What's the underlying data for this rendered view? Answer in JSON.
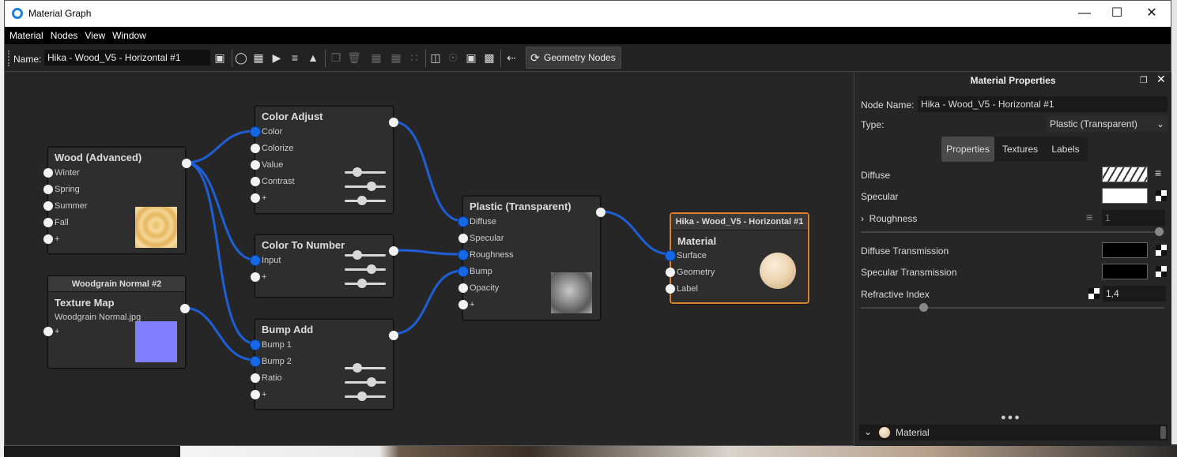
{
  "window": {
    "title": "Material Graph",
    "minimize": "—",
    "maximize": "☐",
    "close": "✕"
  },
  "menu": [
    "Material",
    "Nodes",
    "View",
    "Window"
  ],
  "toolbar": {
    "name_label": "Name:",
    "name_value": "Hika - Wood_V5 - Horizontal #1",
    "geometry_nodes_label": "Geometry Nodes"
  },
  "nodes": {
    "wood": {
      "title": "Wood (Advanced)",
      "ports": [
        "Winter",
        "Spring",
        "Summer",
        "Fall",
        "+"
      ]
    },
    "texture_map": {
      "header": "Woodgrain Normal #2",
      "title": "Texture Map",
      "filename": "Woodgrain Normal.jpg",
      "ports": [
        "+"
      ],
      "swatch_color": "#8080ff"
    },
    "color_adjust": {
      "title": "Color Adjust",
      "ports": [
        "Color",
        "Colorize",
        "Value",
        "Contrast",
        "+"
      ]
    },
    "color_to_number": {
      "title": "Color To Number",
      "ports": [
        "Input",
        "+"
      ]
    },
    "bump_add": {
      "title": "Bump Add",
      "ports": [
        "Bump 1",
        "Bump 2",
        "Ratio",
        "+"
      ]
    },
    "plastic": {
      "title": "Plastic (Transparent)",
      "ports": [
        "Diffuse",
        "Specular",
        "Roughness",
        "Bump",
        "Opacity",
        "+"
      ]
    },
    "material": {
      "header": "Hika - Wood_V5 - Horizontal #1",
      "title": "Material",
      "ports": [
        "Surface",
        "Geometry",
        "Label"
      ],
      "accent": "#d9822b"
    }
  },
  "panel": {
    "title": "Material Properties",
    "node_name_label": "Node Name:",
    "node_name_value": "Hika - Wood_V5 - Horizontal #1",
    "type_label": "Type:",
    "type_value": "Plastic (Transparent)",
    "tabs": [
      "Properties",
      "Textures",
      "Labels"
    ],
    "diffuse_label": "Diffuse",
    "specular_label": "Specular",
    "roughness_label": "Roughness",
    "roughness_value": "1",
    "diffuse_trans_label": "Diffuse Transmission",
    "specular_trans_label": "Specular Transmission",
    "refractive_label": "Refractive Index",
    "refractive_value": "1,4",
    "dots": "●●●",
    "bottom_label": "Material"
  },
  "colors": {
    "wire": "#1e5fd6",
    "port_active": "#1768e6",
    "selected_border": "#d9822b"
  }
}
